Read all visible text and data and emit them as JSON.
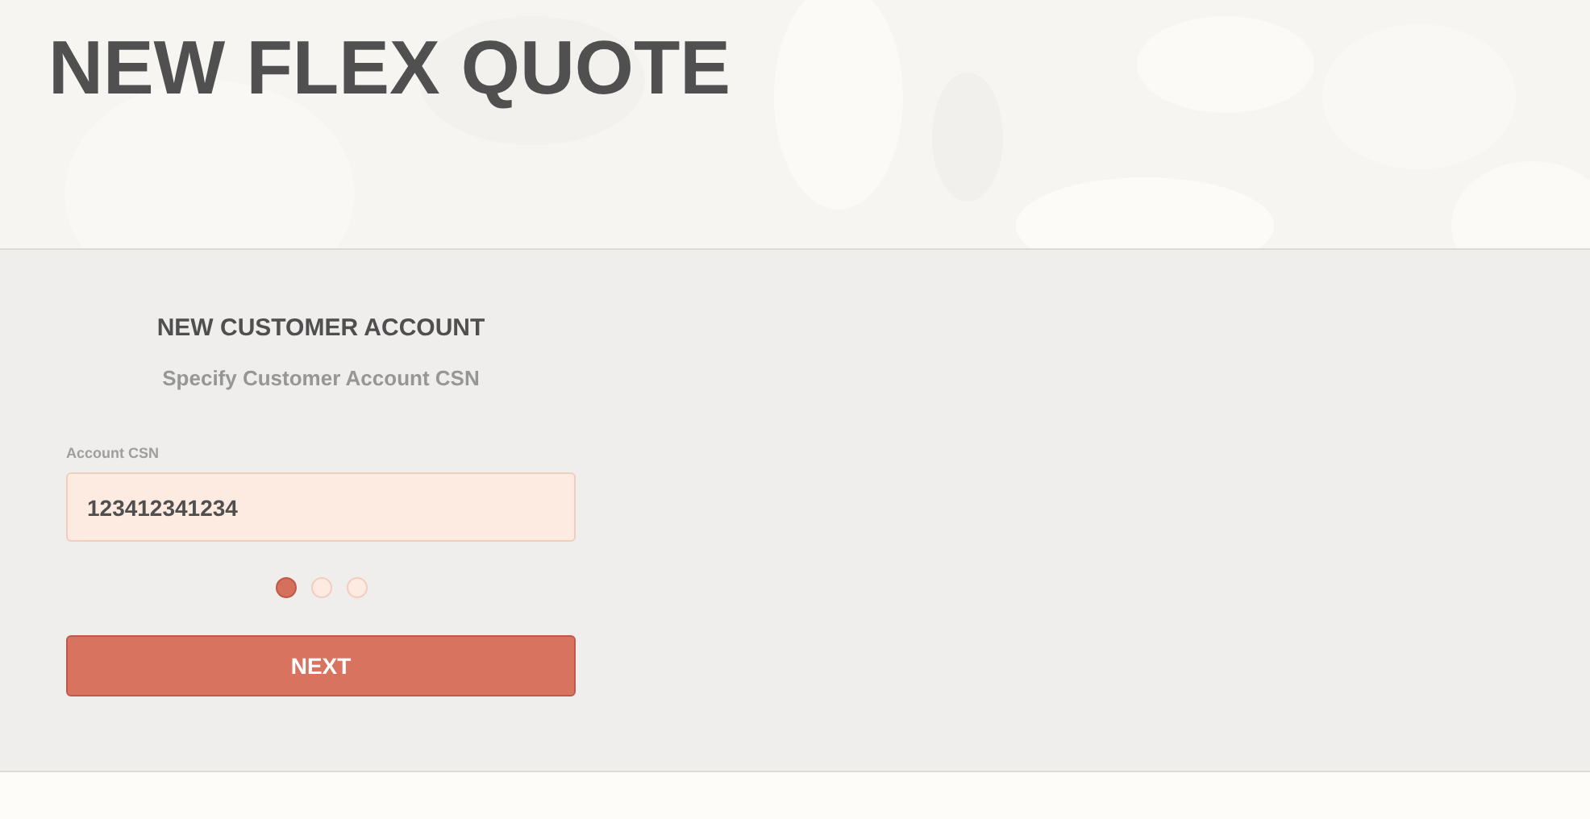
{
  "header": {
    "title": "NEW FLEX QUOTE"
  },
  "form": {
    "heading": "NEW CUSTOMER ACCOUNT",
    "subheading": "Specify Customer Account CSN",
    "field": {
      "label": "Account CSN",
      "value": "123412341234"
    },
    "steps": [
      {
        "selected": true
      },
      {
        "selected": false
      },
      {
        "selected": false
      }
    ],
    "button": "NEXT"
  }
}
